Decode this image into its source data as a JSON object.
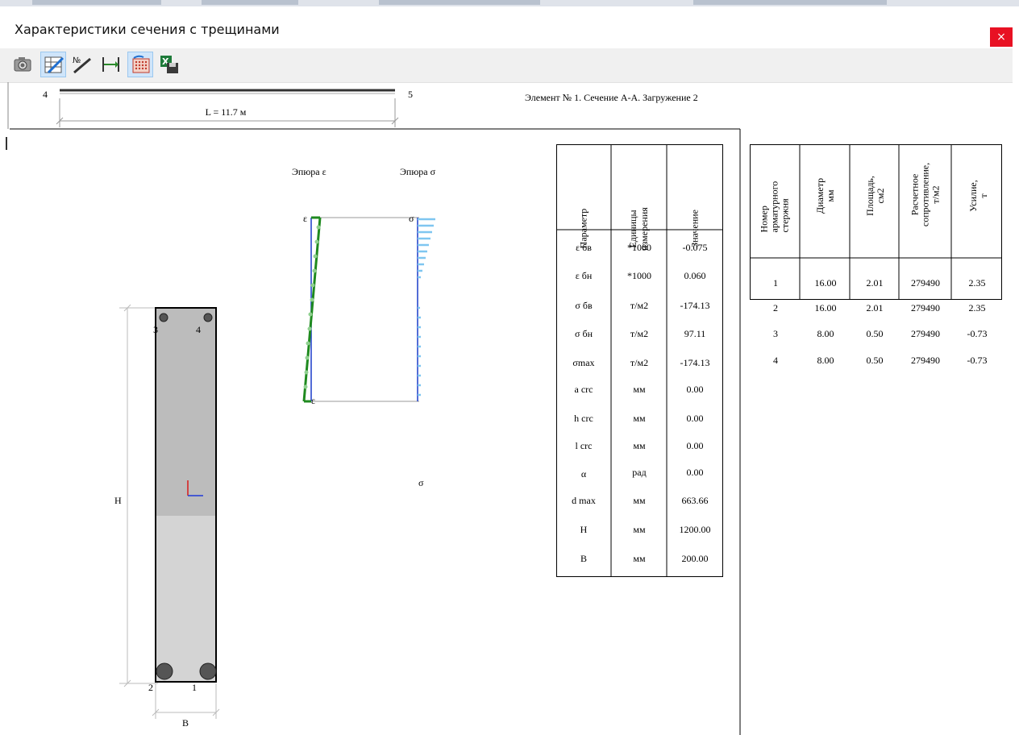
{
  "window": {
    "title": "Характеристики сечения с трещинами",
    "close_label": "×"
  },
  "toolbar": {
    "buttons": [
      {
        "icon": "camera-icon",
        "active": false
      },
      {
        "icon": "table-edit-icon",
        "active": true
      },
      {
        "icon": "numbering-icon",
        "active": false
      },
      {
        "icon": "dimension-icon",
        "active": false
      },
      {
        "icon": "section-grid-icon",
        "active": true
      },
      {
        "icon": "excel-export-icon",
        "active": false
      }
    ]
  },
  "beam": {
    "node_start": "4",
    "node_end": "5",
    "length_label": "L = 11.7 м",
    "caption": "Элемент № 1. Сечение А-А. Загружение 2"
  },
  "section": {
    "height_label": "H",
    "width_label": "B",
    "bars": [
      "1",
      "2",
      "3",
      "4"
    ]
  },
  "diagrams": {
    "strain_title": "Эпюра ε",
    "stress_title": "Эпюра σ",
    "eps_top": "ε",
    "eps_bottom": "ε",
    "sigma_top": "σ",
    "sigma_label": "σ"
  },
  "params_table": {
    "headers": [
      "Параметр",
      "Единицы измерения",
      "Значение"
    ],
    "rows": [
      {
        "param": "ε бв",
        "unit": "*1000",
        "value": "-0.075"
      },
      {
        "param": "ε бн",
        "unit": "*1000",
        "value": "0.060"
      },
      {
        "param": "σ бв",
        "unit": "т/м2",
        "value": "-174.13"
      },
      {
        "param": "σ бн",
        "unit": "т/м2",
        "value": "97.11"
      },
      {
        "param": "σmax",
        "unit": "т/м2",
        "value": "-174.13"
      },
      {
        "param": "a crc",
        "unit": "мм",
        "value": "0.00"
      },
      {
        "param": "h crc",
        "unit": "мм",
        "value": "0.00"
      },
      {
        "param": "l crc",
        "unit": "мм",
        "value": "0.00"
      },
      {
        "param": "α",
        "unit": "рад",
        "value": "0.00"
      },
      {
        "param": "d max",
        "unit": "мм",
        "value": "663.66"
      },
      {
        "param": "H",
        "unit": "мм",
        "value": "1200.00"
      },
      {
        "param": "B",
        "unit": "мм",
        "value": "200.00"
      }
    ]
  },
  "rebar_table": {
    "headers": [
      [
        "Номер",
        "арматурного",
        "стержня"
      ],
      [
        "Диаметр",
        "мм"
      ],
      [
        "Площадь,",
        "см2"
      ],
      [
        "Расчетное",
        "сопротивление,",
        "т/м2"
      ],
      [
        "Усилие,",
        "т"
      ]
    ],
    "rows": [
      [
        "1",
        "16.00",
        "2.01",
        "279490",
        "2.35"
      ],
      [
        "2",
        "16.00",
        "2.01",
        "279490",
        "2.35"
      ],
      [
        "3",
        "8.00",
        "0.50",
        "279490",
        "-0.73"
      ],
      [
        "4",
        "8.00",
        "0.50",
        "279490",
        "-0.73"
      ]
    ]
  },
  "colors": {
    "strain_line": "#1f8a1f",
    "stress_line": "#1a3cc8",
    "stress_points": "#7fc6f0",
    "section_top": "#bcbcbc",
    "section_bottom": "#d4d4d4",
    "close_button": "#e81123"
  }
}
